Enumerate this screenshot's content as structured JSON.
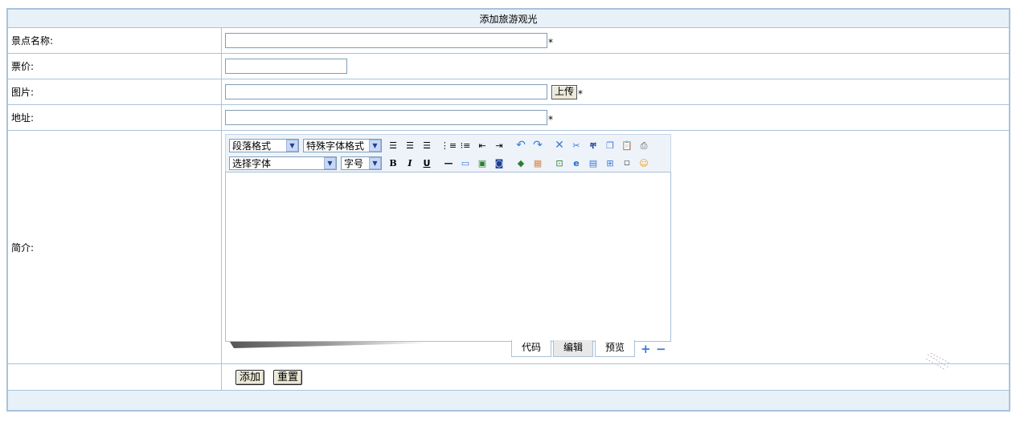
{
  "form": {
    "title": "添加旅游观光",
    "name_label": "景点名称:",
    "name_value": "",
    "name_required": "*",
    "price_label": "票价:",
    "price_value": "",
    "image_label": "图片:",
    "image_value": "",
    "upload_label": "上传",
    "image_required": "*",
    "address_label": "地址:",
    "address_value": "",
    "address_required": "*",
    "intro_label": "简介:",
    "add_label": "添加",
    "reset_label": "重置"
  },
  "editor": {
    "paragraph_format": "段落格式",
    "special_font_format": "特殊字体格式",
    "font_select": "选择字体",
    "font_size": "字号",
    "content": "",
    "mode_code": "代码",
    "mode_edit": "编辑",
    "mode_preview": "预览",
    "active_mode": "编辑",
    "icons_row1": [
      "align-left-icon",
      "align-center-icon",
      "align-right-icon",
      "unordered-list-icon",
      "ordered-list-icon",
      "outdent-icon",
      "indent-icon",
      "undo-icon",
      "redo-icon",
      "delete-icon",
      "cut-icon",
      "find-icon",
      "copy-icon",
      "paste-icon",
      "print-icon"
    ],
    "icons_row2": [
      "bold-icon",
      "italic-icon",
      "underline-icon",
      "horizontal-rule-icon",
      "insert-table-icon",
      "insert-image-icon",
      "insert-media-icon",
      "insert-flash-icon",
      "color-picker-icon",
      "insert-file-icon",
      "insert-link-icon",
      "insert-template-icon",
      "insert-special-icon",
      "insert-date-icon",
      "emoticon-icon"
    ]
  },
  "colors": {
    "border": "#a9c3dc",
    "header_bg": "#e9f1f8",
    "toolbar_bg": "#eef3fa"
  }
}
